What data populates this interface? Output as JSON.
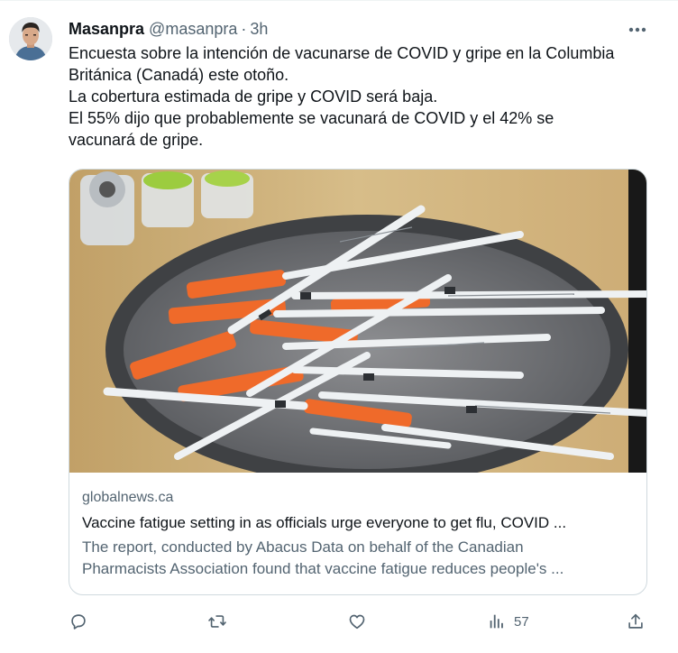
{
  "tweet": {
    "author_name": "Masanpra",
    "author_handle": "@masanpra",
    "separator": "·",
    "timestamp": "3h",
    "text_lines": [
      "Encuesta sobre la intención de vacunarse de COVID y gripe en la Columbia",
      "Británica (Canadá) este otoño.",
      "La cobertura estimada de gripe y COVID será baja.",
      "El 55% dijo que probablemente se vacunará de COVID y el 42% se",
      "vacunará de gripe."
    ]
  },
  "card": {
    "domain": "globalnews.ca",
    "title": "Vaccine fatigue setting in as officials urge everyone to get flu, COVID ...",
    "description_lines": [
      "The report, conducted by Abacus Data on behalf of the Canadian",
      "Pharmacists Association found that vaccine fatigue reduces people's ..."
    ]
  },
  "actions": {
    "views_count": "57"
  },
  "icons": {
    "more": "more-icon",
    "reply": "reply-icon",
    "retweet": "retweet-icon",
    "like": "heart-icon",
    "views": "bar-chart-icon",
    "share": "share-icon"
  },
  "colors": {
    "text": "#0f1419",
    "secondary": "#536471",
    "border": "#cfd9de"
  }
}
